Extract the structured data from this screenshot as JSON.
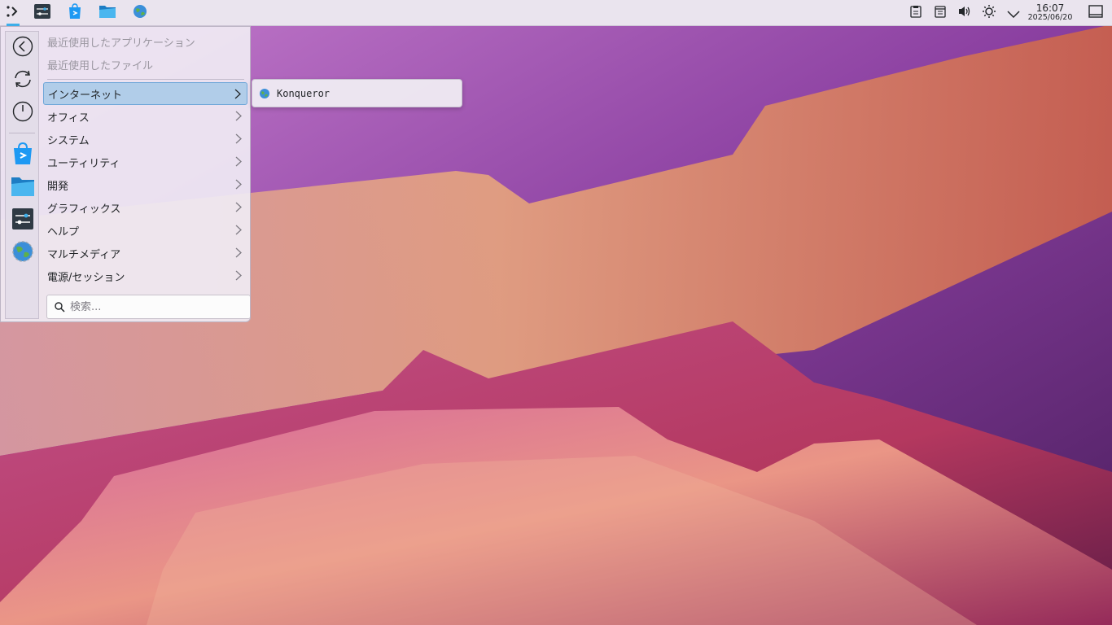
{
  "menu": {
    "recent_apps": "最近使用したアプリケーション",
    "recent_files": "最近使用したファイル",
    "categories": [
      {
        "label": "インターネット"
      },
      {
        "label": "オフィス"
      },
      {
        "label": "システム"
      },
      {
        "label": "ユーティリティ"
      },
      {
        "label": "開発"
      },
      {
        "label": "グラフィックス"
      },
      {
        "label": "ヘルプ"
      },
      {
        "label": "マルチメディア"
      },
      {
        "label": "電源/セッション"
      }
    ],
    "search_placeholder": "検索..."
  },
  "submenu": {
    "items": [
      {
        "label": "Konqueror"
      }
    ]
  },
  "clock": {
    "time": "16:07",
    "date": "2025/06/20"
  },
  "colors": {
    "accent": "#3daee9",
    "highlight": "#b1cde9",
    "panel": "#eae4ee"
  }
}
